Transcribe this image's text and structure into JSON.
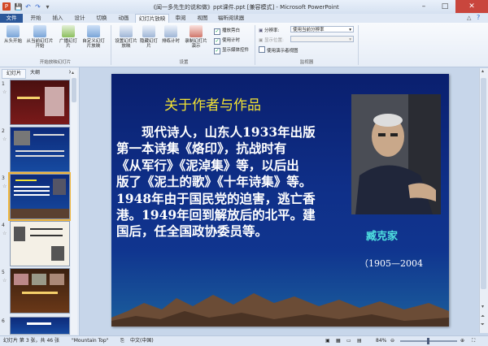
{
  "window": {
    "title": "《闻一多先生的说和做》ppt课件.ppt [兼容模式] - Microsoft PowerPoint",
    "minimize": "–",
    "maximize": "□",
    "close": "✕"
  },
  "quick_access": [
    "save-icon",
    "undo-icon",
    "redo-icon"
  ],
  "tabs": [
    "文件",
    "开始",
    "插入",
    "设计",
    "切换",
    "动画",
    "幻灯片放映",
    "审阅",
    "视图",
    "福昕阅读器"
  ],
  "ribbon": {
    "start_group": {
      "from_start": "从头开始",
      "from_current": "从当前幻灯片开始",
      "broadcast": "广播幻灯片",
      "custom": "自定义幻灯片放映",
      "label": "开始放映幻灯片"
    },
    "setup_group": {
      "setup": "设置幻灯片放映",
      "hide": "隐藏幻灯片",
      "rehearse": "排练计时",
      "record": "录制幻灯片演示",
      "chk_narration": "播放旁白",
      "chk_timings": "使用计时",
      "chk_media": "显示媒体控件",
      "label": "设置"
    },
    "monitor_group": {
      "resolution_label": "分辨率:",
      "resolution_value": "使用当前分辨率",
      "show_on_label": "显示位置:",
      "show_on_value": "",
      "presenter_view": "使用演示者视图",
      "label": "监视器"
    }
  },
  "panel": {
    "tab_slides": "幻灯片",
    "tab_outline": "大纲",
    "slide_numbers": [
      "1",
      "2",
      "3",
      "4",
      "5",
      "6"
    ]
  },
  "slide": {
    "title": "关于作者与作品",
    "body_lines": [
      "　　现代诗人，山东人1933年出版",
      "第一本诗集《烙印》，抗战时有",
      "《从军行》《泥淖集》等，以后出",
      "版了《泥土的歌》《十年诗集》等。",
      "1948年由于国民党的迫害，逃亡香",
      "港。1949年回到解放后的北平。建",
      "国后，任全国政协委员等。"
    ],
    "author_name": "臧克家",
    "author_years": "（1905—2004"
  },
  "status": {
    "slide_info": "幻灯片 第 3 张，共 46 张",
    "theme": "\"Mountain Top\"",
    "language": "中文(中国)",
    "zoom": "84%"
  },
  "colors": {
    "file_tab": "#2b579a",
    "slide_title": "#f2e233",
    "author_name": "#4fe0e0",
    "selected_thumb": "#f0b53a"
  }
}
